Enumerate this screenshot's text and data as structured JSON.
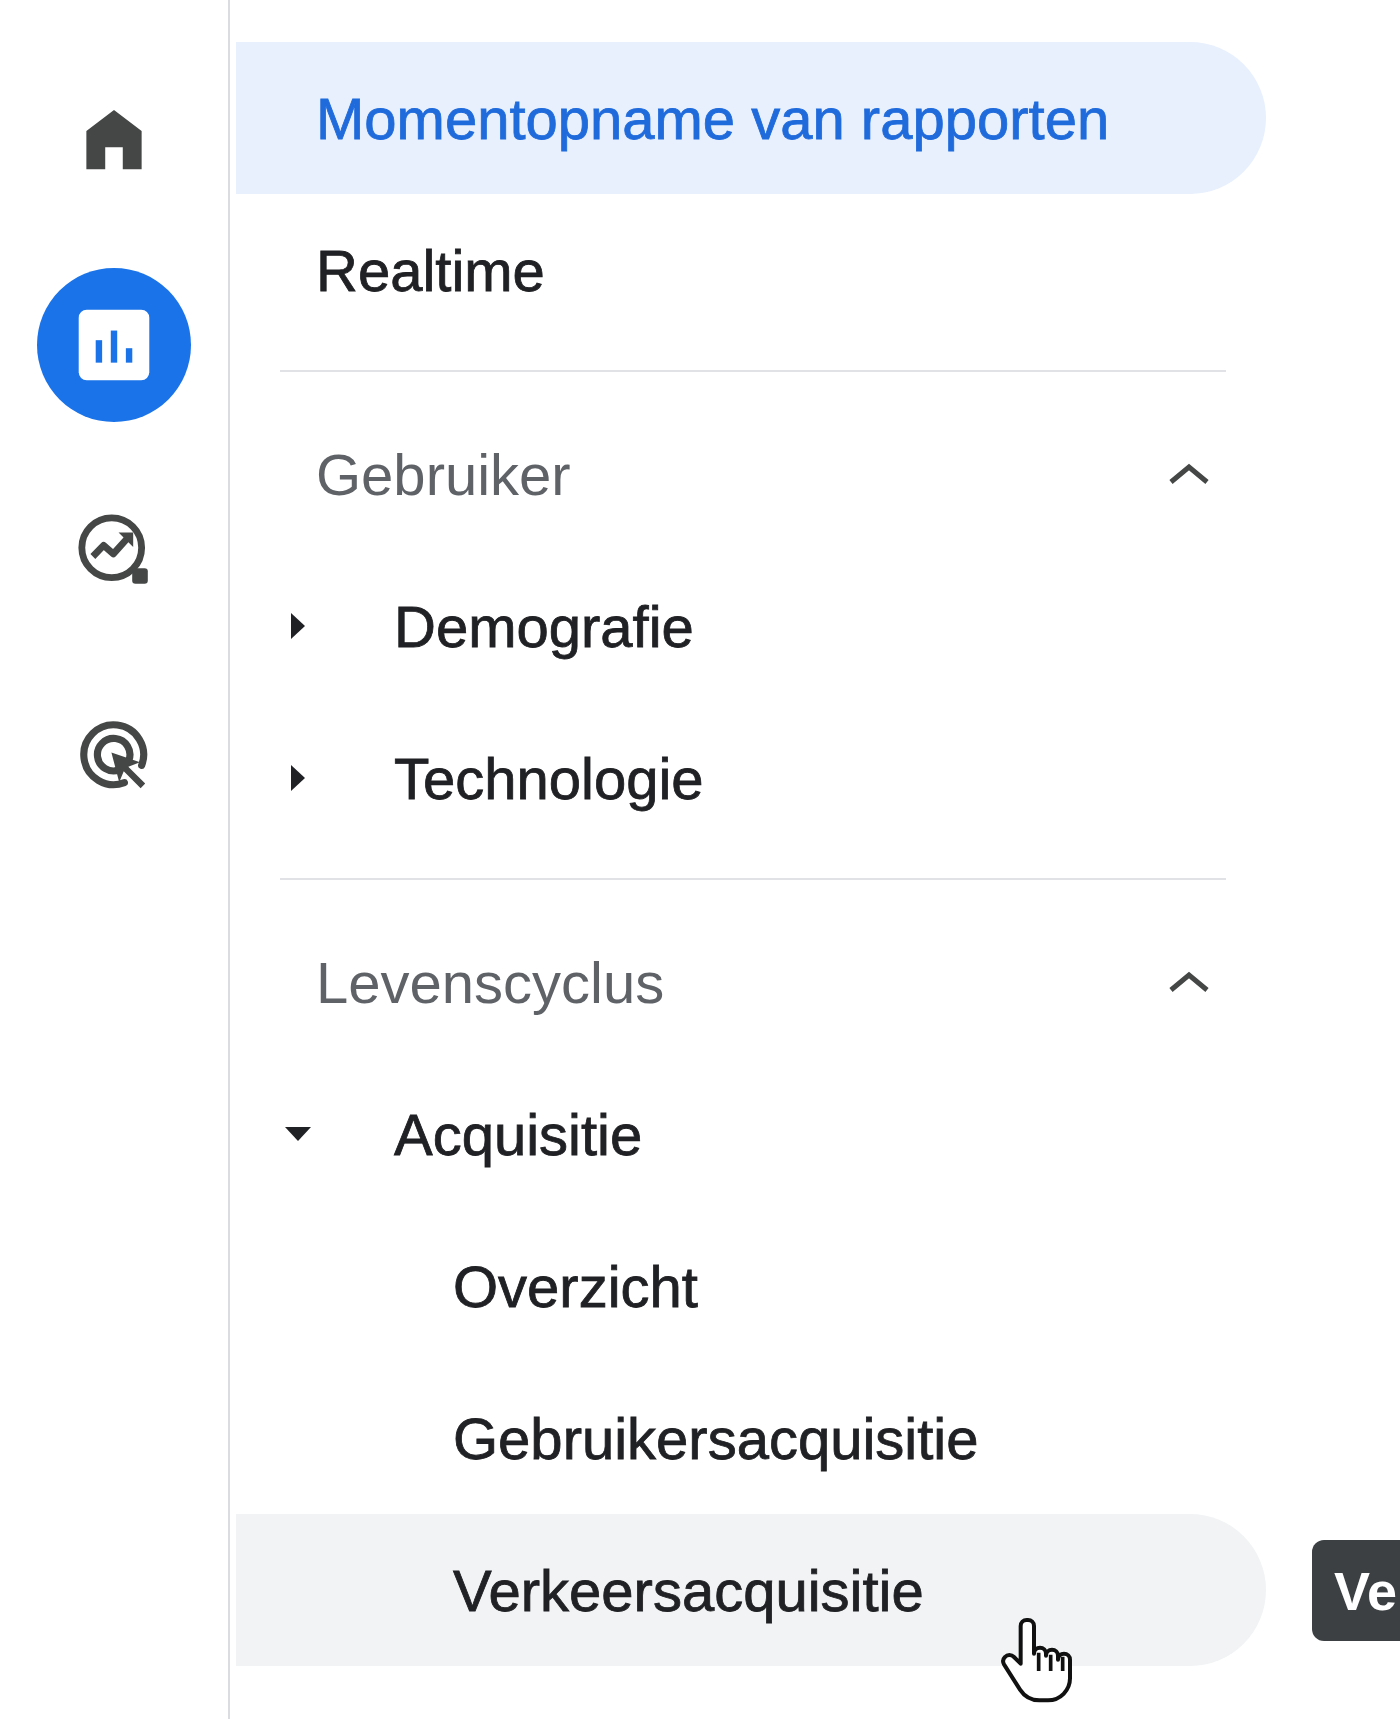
{
  "nav_rail": {
    "items": [
      {
        "kind": "home",
        "selected": false
      },
      {
        "kind": "reports",
        "selected": true
      },
      {
        "kind": "explore",
        "selected": false
      },
      {
        "kind": "advertising",
        "selected": false
      }
    ]
  },
  "nav": {
    "top_items": [
      {
        "label": "Momentopname van rapporten",
        "selected": true,
        "hovered": false
      },
      {
        "label": "Realtime",
        "selected": false,
        "hovered": false
      }
    ],
    "sections": [
      {
        "title": "Gebruiker",
        "expanded": true,
        "items": [
          {
            "label": "Demografie",
            "expanded": false
          },
          {
            "label": "Technologie",
            "expanded": false
          }
        ]
      },
      {
        "title": "Levenscyclus",
        "expanded": true,
        "items": [
          {
            "label": "Acquisitie",
            "expanded": true,
            "children": [
              {
                "label": "Overzicht",
                "selected": false,
                "hovered": false
              },
              {
                "label": "Gebruikersacquisitie",
                "selected": false,
                "hovered": false
              },
              {
                "label": "Verkeersacquisitie",
                "selected": false,
                "hovered": true
              }
            ]
          }
        ]
      }
    ]
  },
  "tooltip": {
    "text": "Ve"
  }
}
